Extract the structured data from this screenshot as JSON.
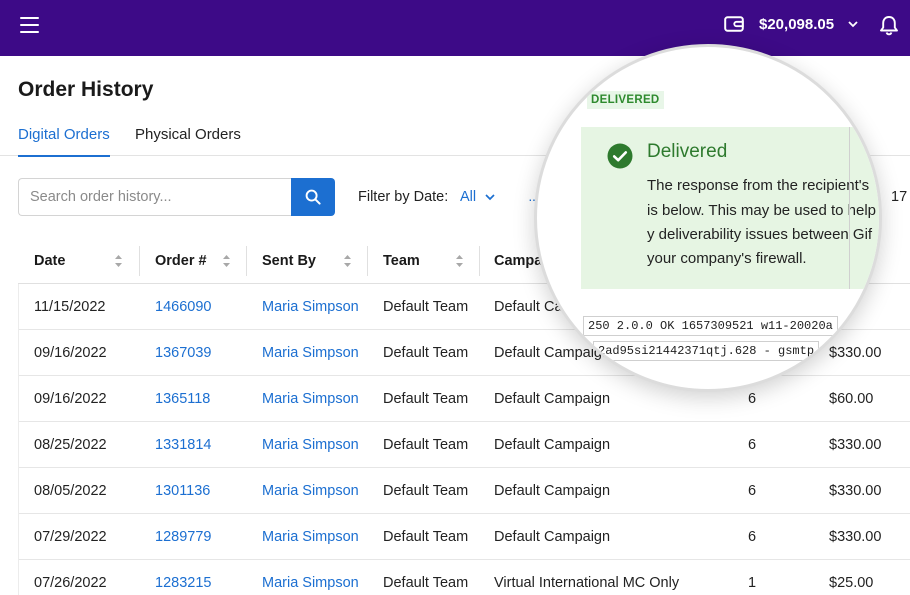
{
  "topbar": {
    "wallet_amount": "$20,098.05"
  },
  "page": {
    "title": "Order History"
  },
  "tabs": [
    {
      "label": "Digital Orders",
      "active": true
    },
    {
      "label": "Physical Orders",
      "active": false
    }
  ],
  "search": {
    "placeholder": "Search order history..."
  },
  "filter": {
    "label": "Filter by Date:",
    "value": "All",
    "more": "··",
    "count": "17"
  },
  "table": {
    "headers": [
      "Date",
      "Order #",
      "Sent By",
      "Team",
      "Campaign"
    ],
    "rows": [
      {
        "date": "11/15/2022",
        "order": "1466090",
        "sent_by": "Maria Simpson",
        "team": "Default Team",
        "campaign": "Default Ca",
        "qty": "",
        "amount": ".00"
      },
      {
        "date": "09/16/2022",
        "order": "1367039",
        "sent_by": "Maria Simpson",
        "team": "Default Team",
        "campaign": "Default Campaign",
        "qty": "",
        "amount": "$330.00"
      },
      {
        "date": "09/16/2022",
        "order": "1365118",
        "sent_by": "Maria Simpson",
        "team": "Default Team",
        "campaign": "Default Campaign",
        "qty": "6",
        "amount": "$60.00"
      },
      {
        "date": "08/25/2022",
        "order": "1331814",
        "sent_by": "Maria Simpson",
        "team": "Default Team",
        "campaign": "Default Campaign",
        "qty": "6",
        "amount": "$330.00"
      },
      {
        "date": "08/05/2022",
        "order": "1301136",
        "sent_by": "Maria Simpson",
        "team": "Default Team",
        "campaign": "Default Campaign",
        "qty": "6",
        "amount": "$330.00"
      },
      {
        "date": "07/29/2022",
        "order": "1289779",
        "sent_by": "Maria Simpson",
        "team": "Default Team",
        "campaign": "Default Campaign",
        "qty": "6",
        "amount": "$330.00"
      },
      {
        "date": "07/26/2022",
        "order": "1283215",
        "sent_by": "Maria Simpson",
        "team": "Default Team",
        "campaign": "Virtual International MC Only",
        "qty": "1",
        "amount": "$25.00"
      }
    ]
  },
  "magnifier": {
    "badge": "DELIVERED",
    "title": "Delivered",
    "lines": [
      "The response from the recipient's",
      "is below. This may be used to help",
      "y deliverability issues between Gif",
      "your company's firewall."
    ],
    "code_lines": [
      "250 2.0.0 OK 1657309521 w11-20020a",
      "2ad95si21442371qtj.628 - gsmtp"
    ]
  },
  "colors": {
    "topbar": "#3d0a87",
    "accent": "#1c6fd1",
    "success": "#2e7a2e",
    "success_bg": "#e6f5e3"
  }
}
